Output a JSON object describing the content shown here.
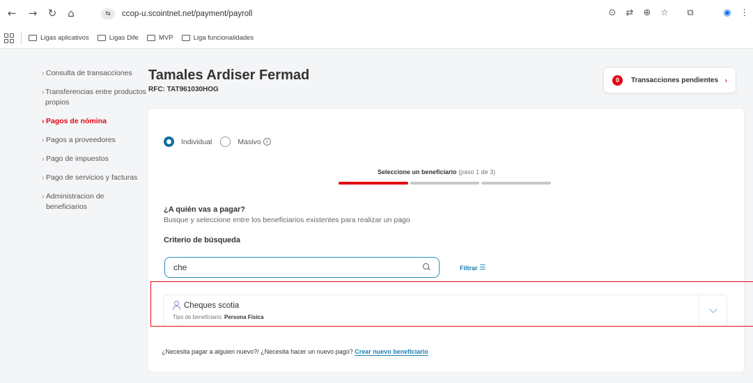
{
  "browser": {
    "url": "ccop-u.scointnet.net/payment/payroll",
    "bookmarks": [
      "Ligas aplicativos",
      "Ligas Dife",
      "MVP",
      "Liga funcionalidades"
    ]
  },
  "sidebar": {
    "items": [
      {
        "label": "Consulta de transacciones",
        "active": false
      },
      {
        "label": "Transferencias entre productos propios",
        "active": false
      },
      {
        "label": "Pagos de nómina",
        "active": true
      },
      {
        "label": "Pagos a proveedores",
        "active": false
      },
      {
        "label": "Pago de impuestos",
        "active": false
      },
      {
        "label": "Pago de servicios y facturas",
        "active": false
      },
      {
        "label": "Administracion de beneficiarios",
        "active": false
      }
    ]
  },
  "header": {
    "company": "Tamales Ardiser Fermad",
    "rfc": "RFC: TAT961030HOG",
    "pending_count": "0",
    "pending_label": "Transacciones pendientes"
  },
  "form": {
    "radio_individual": "Individual",
    "radio_masivo": "Masivo",
    "step_label": "Seleccione un beneficiario",
    "step_sub": "(paso 1 de 3)",
    "progress_step": 1,
    "progress_total": 3,
    "question": "¿A quién vas a pagar?",
    "question_desc": "Busque y seleccione entre los beneficiarios existentes para realizar un pago",
    "criteria_label": "Criterio de búsqueda",
    "search_value": "che",
    "filter_label": "Filtrar"
  },
  "result": {
    "name": "Cheques scotia",
    "type_label": "Tipo de beneficiario:",
    "type_value": "Persona Física"
  },
  "footer": {
    "prompt": "¿Necesita pagar a alguien nuevo?/ ¿Necesita hacer un nuevo pago?",
    "link": "Crear nuevo beneficiario"
  },
  "colors": {
    "accent_red": "#e30613",
    "link_blue": "#1b80b5",
    "radio_blue": "#0d6e9e"
  }
}
